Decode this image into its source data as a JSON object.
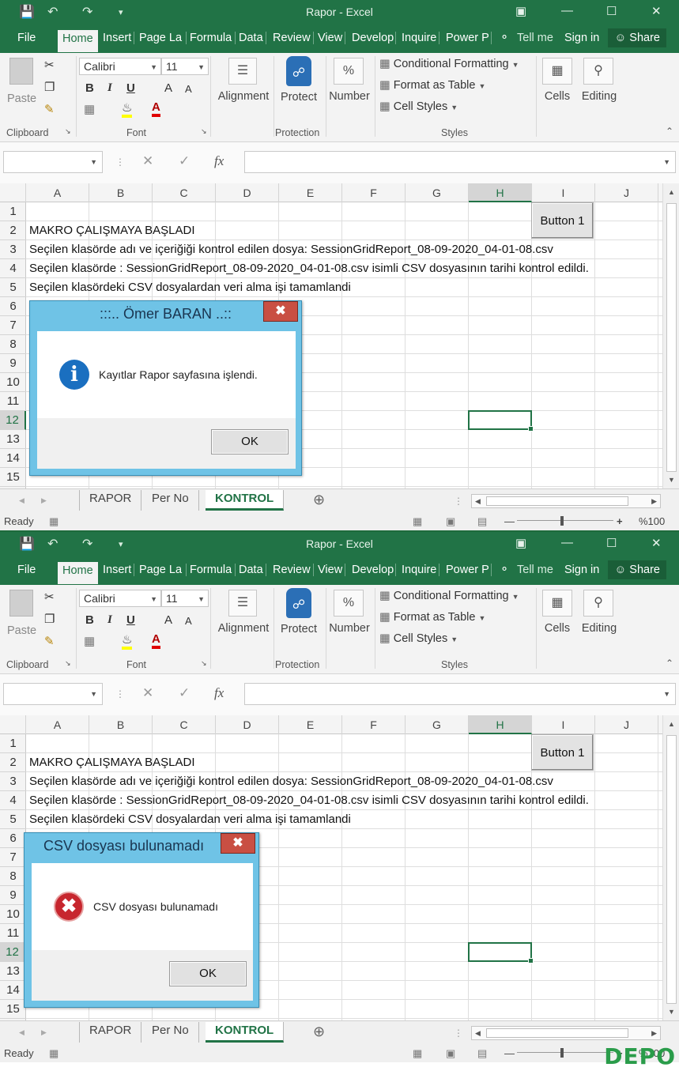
{
  "app": {
    "window_title": "Rapor - Excel",
    "tabs": [
      {
        "label": "File"
      },
      {
        "label": "Home"
      },
      {
        "label": "Insert"
      },
      {
        "label": "Page La"
      },
      {
        "label": "Formula"
      },
      {
        "label": "Data"
      },
      {
        "label": "Review"
      },
      {
        "label": "View"
      },
      {
        "label": "Develop"
      },
      {
        "label": "Inquire"
      },
      {
        "label": "Power P"
      },
      {
        "label": "Tell me"
      },
      {
        "label": "Sign in"
      },
      {
        "label": "Share"
      }
    ],
    "ribbon": {
      "paste": "Paste",
      "clipboard": "Clipboard",
      "font_name": "Calibri",
      "font_size": "11",
      "font": "Font",
      "bold": "B",
      "italic": "I",
      "underline": "U",
      "grow": "A",
      "shrink": "A",
      "font_color_glyph": "A",
      "alignment": "Alignment",
      "protect": "Protect",
      "protection": "Protection",
      "number": "Number",
      "percent_glyph": "%",
      "conditional_formatting": "Conditional Formatting",
      "format_as_table": "Format as Table",
      "cell_styles": "Cell Styles",
      "styles": "Styles",
      "cells": "Cells",
      "editing": "Editing"
    },
    "formula_fx": "fx",
    "columns": [
      "A",
      "B",
      "C",
      "D",
      "E",
      "F",
      "G",
      "H",
      "I",
      "J"
    ],
    "rows": [
      "1",
      "2",
      "3",
      "4",
      "5",
      "6",
      "7",
      "8",
      "9",
      "10",
      "11",
      "12",
      "13",
      "14",
      "15"
    ],
    "cells": {
      "a2": "MAKRO ÇALIŞMAYA BAŞLADI",
      "a3": "Seçilen klasörde adı ve içeriğiği kontrol edilen dosya: SessionGridReport_08-09-2020_04-01-08.csv",
      "a4": "Seçilen klasörde : SessionGridReport_08-09-2020_04-01-08.csv isimli CSV dosyasının tarihi kontrol edildi.",
      "a5": "Seçilen klasördeki CSV dosyalardan veri alma işi tamamlandi"
    },
    "button1": "Button 1",
    "sheet_tabs": [
      "RAPOR",
      "Per No",
      "KONTROL"
    ],
    "status": {
      "ready": "Ready",
      "zoom": "%100"
    }
  },
  "dialog1": {
    "title": ":::.. Ömer BARAN ..::",
    "message": "Kayıtlar Rapor sayfasına işlendi.",
    "ok": "OK",
    "icon": "info-icon"
  },
  "dialog2": {
    "title": "CSV dosyası bulunamadı",
    "message": "CSV dosyası bulunamadı",
    "ok": "OK",
    "icon": "error-icon"
  },
  "watermark": "DEPO",
  "colors": {
    "excel_green": "#217346",
    "dialog_frame": "#6fc3e6",
    "close_red": "#c94f43"
  }
}
